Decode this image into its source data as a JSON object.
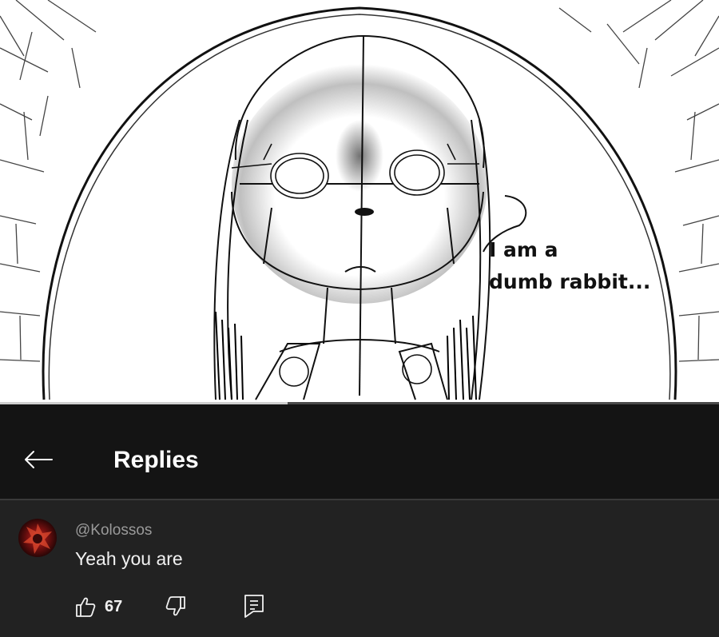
{
  "video": {
    "speech_bubble_text": "I am a\ndumb rabbit...",
    "progress_fraction": 0.4
  },
  "header": {
    "back_icon": "arrow-left-icon",
    "title": "Replies"
  },
  "comment": {
    "author": "@Kolossos",
    "text": "Yeah you are",
    "like_count": "67",
    "like_icon": "thumbs-up-icon",
    "dislike_icon": "thumbs-down-icon",
    "reply_icon": "reply-comment-icon"
  },
  "colors": {
    "header_bg": "#141414",
    "panel_bg": "#222222",
    "primary_text": "#f1f1f1",
    "secondary_text": "#9a9a9a"
  }
}
